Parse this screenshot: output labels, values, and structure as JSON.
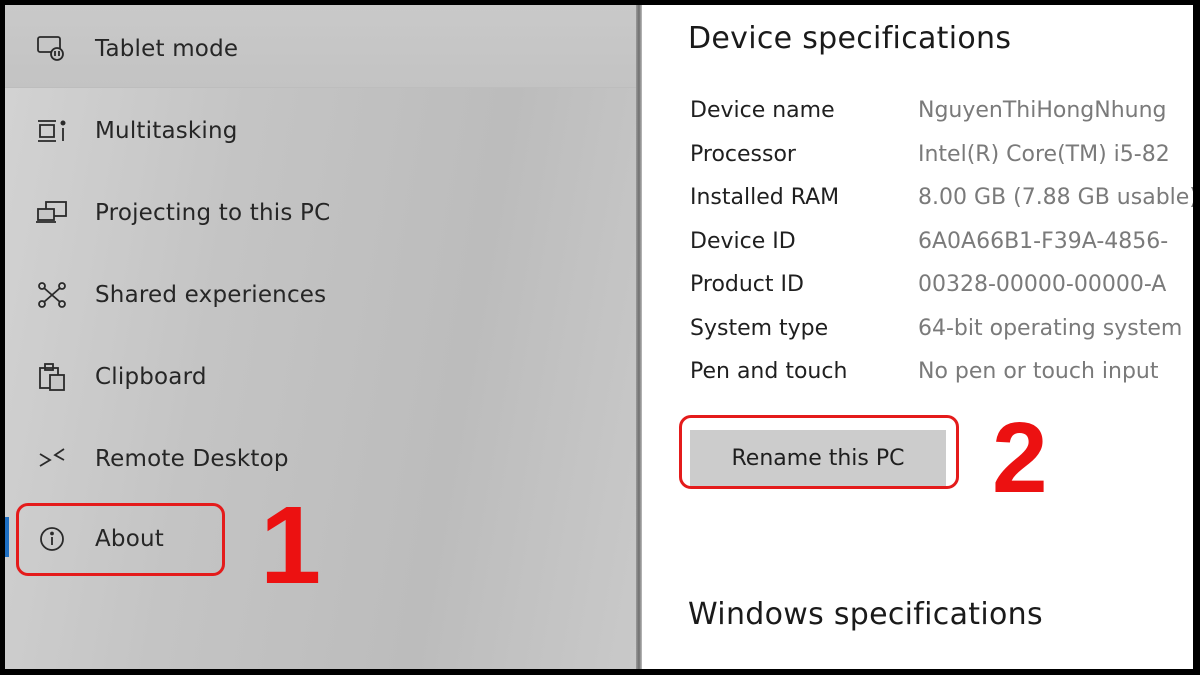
{
  "sidebar": {
    "items": [
      {
        "label": "Tablet mode",
        "icon": "tablet-mode-icon"
      },
      {
        "label": "Multitasking",
        "icon": "multitasking-icon"
      },
      {
        "label": "Projecting to this PC",
        "icon": "projecting-icon"
      },
      {
        "label": "Shared experiences",
        "icon": "shared-experiences-icon"
      },
      {
        "label": "Clipboard",
        "icon": "clipboard-icon"
      },
      {
        "label": "Remote Desktop",
        "icon": "remote-desktop-icon"
      },
      {
        "label": "About",
        "icon": "info-icon",
        "selected": true
      }
    ]
  },
  "device_specs": {
    "title": "Device specifications",
    "rows": [
      {
        "key": "Device name",
        "value": "NguyenThiHongNhung"
      },
      {
        "key": "Processor",
        "value": "Intel(R) Core(TM) i5-82"
      },
      {
        "key": "Installed RAM",
        "value": "8.00 GB (7.88 GB usable)"
      },
      {
        "key": "Device ID",
        "value": "6A0A66B1-F39A-4856-"
      },
      {
        "key": "Product ID",
        "value": "00328-00000-00000-A"
      },
      {
        "key": "System type",
        "value": "64-bit operating system"
      },
      {
        "key": "Pen and touch",
        "value": "No pen or touch input"
      }
    ],
    "rename_button": "Rename this PC"
  },
  "windows_specs": {
    "title": "Windows specifications"
  },
  "annotations": {
    "step1": "1",
    "step2": "2",
    "color": "#e41b1b"
  },
  "colors": {
    "accent": "#1e6fc3",
    "annotation_red": "#e41b1b"
  }
}
